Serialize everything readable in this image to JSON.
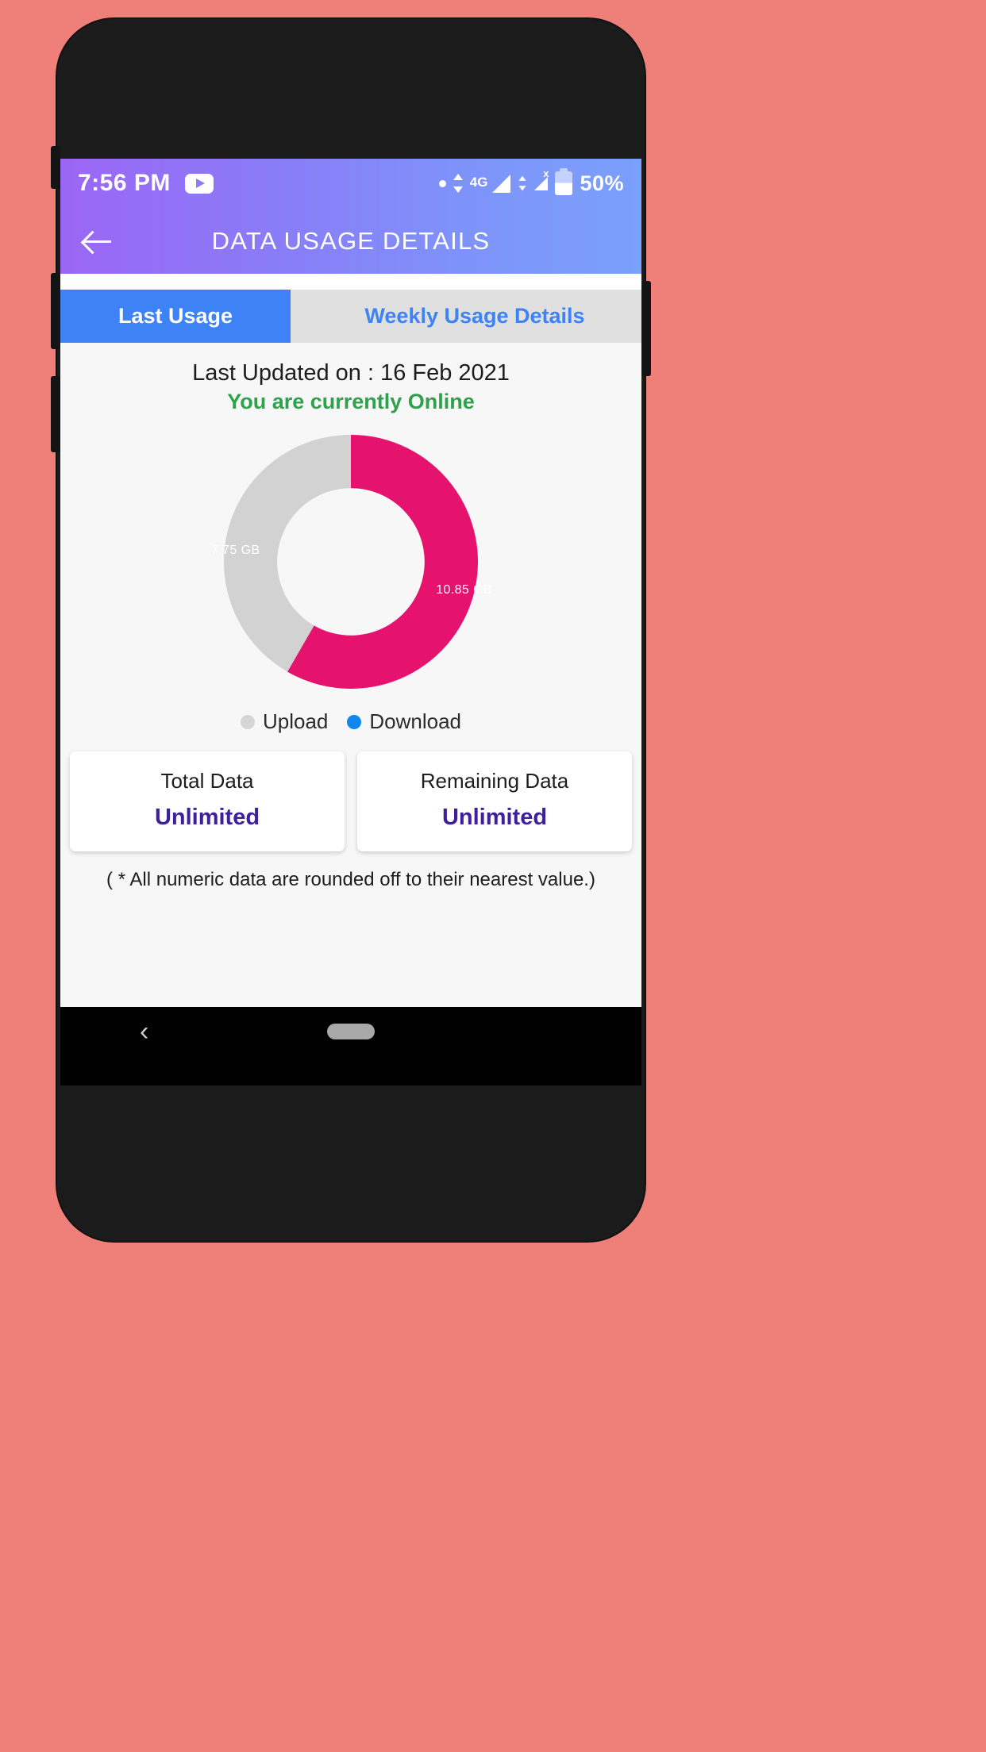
{
  "status_bar": {
    "time": "7:56 PM",
    "app_icon": "youtube-icon",
    "dot_icon": "notification-dot-icon",
    "network_type": "4G",
    "signal_icon": "signal-bars-icon",
    "data_arrows_icon": "data-transfer-arrows-icon",
    "sim2_signal_icon": "signal-no-service-icon",
    "sim2_x": "x",
    "battery_icon": "battery-icon",
    "battery_percent": "50%"
  },
  "app_bar": {
    "back_icon": "back-arrow-icon",
    "title": "DATA USAGE DETAILS"
  },
  "tabs": [
    {
      "label": "Last Usage",
      "active": true
    },
    {
      "label": "Weekly Usage Details",
      "active": false
    }
  ],
  "content": {
    "last_updated": "Last Updated on : 16 Feb 2021",
    "online_status": "You are currently Online",
    "footnote": "( * All numeric data are rounded off to their nearest value.)"
  },
  "legend": {
    "upload_label": "Upload",
    "download_label": "Download",
    "upload_color": "#d6d6d6",
    "download_color": "#0f86f0"
  },
  "cards": [
    {
      "title": "Total Data",
      "value": "Unlimited"
    },
    {
      "title": "Remaining Data",
      "value": "Unlimited"
    }
  ],
  "nav_bar": {
    "back_icon": "nav-back-chevron-icon",
    "home_icon": "nav-home-pill-icon"
  },
  "colors": {
    "header_gradient_start": "#9b66f5",
    "header_gradient_end": "#7aa0fb",
    "tab_active_bg": "#3d83f5",
    "tab_inactive_bg": "#e0e0e0",
    "online_green": "#2ea14a",
    "card_value_purple": "#3f1f9c",
    "page_bg": "#ef8079"
  },
  "chart_data": {
    "type": "pie",
    "variant": "donut",
    "title": "",
    "categories": [
      "Download",
      "Upload"
    ],
    "values": [
      10.85,
      7.75
    ],
    "unit": "GB",
    "labels": [
      "10.85 GB",
      "7.75 GB"
    ],
    "colors": [
      "#e5136e",
      "#d2d2d2"
    ],
    "total": 18.6,
    "percentages": [
      58.3,
      41.7
    ],
    "legend": [
      "Upload",
      "Download"
    ],
    "legend_position": "bottom",
    "start_angle_deg": 0,
    "direction": "clockwise",
    "inner_radius_ratio": 0.58,
    "grid": false
  }
}
